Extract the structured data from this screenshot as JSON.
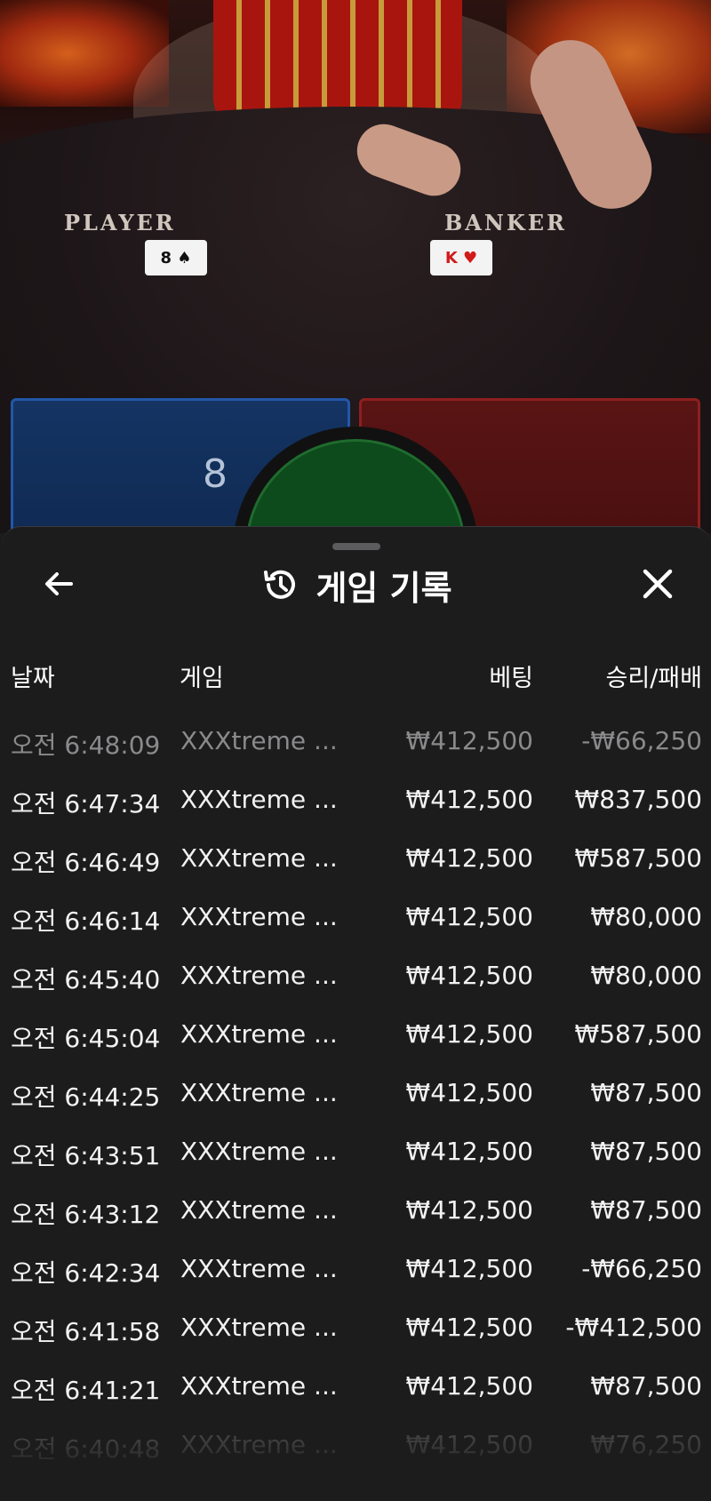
{
  "video": {
    "player_label": "PLAYER",
    "banker_label": "BANKER",
    "player_card": "8 ♠",
    "banker_card": "K ♥",
    "player_score": "8"
  },
  "sheet": {
    "title": "게임 기록",
    "title_icon": "history-icon",
    "back_icon": "arrow-left-icon",
    "close_icon": "close-icon",
    "columns": {
      "date": "날짜",
      "game": "게임",
      "bet": "베팅",
      "win_loss": "승리/패배"
    },
    "rows": [
      {
        "date": "오전 6:48:09",
        "game": "XXXtreme ...",
        "bet": "₩412,500",
        "win_loss": "-₩66,250"
      },
      {
        "date": "오전 6:47:34",
        "game": "XXXtreme ...",
        "bet": "₩412,500",
        "win_loss": "₩837,500"
      },
      {
        "date": "오전 6:46:49",
        "game": "XXXtreme ...",
        "bet": "₩412,500",
        "win_loss": "₩587,500"
      },
      {
        "date": "오전 6:46:14",
        "game": "XXXtreme ...",
        "bet": "₩412,500",
        "win_loss": "₩80,000"
      },
      {
        "date": "오전 6:45:40",
        "game": "XXXtreme ...",
        "bet": "₩412,500",
        "win_loss": "₩80,000"
      },
      {
        "date": "오전 6:45:04",
        "game": "XXXtreme ...",
        "bet": "₩412,500",
        "win_loss": "₩587,500"
      },
      {
        "date": "오전 6:44:25",
        "game": "XXXtreme ...",
        "bet": "₩412,500",
        "win_loss": "₩87,500"
      },
      {
        "date": "오전 6:43:51",
        "game": "XXXtreme ...",
        "bet": "₩412,500",
        "win_loss": "₩87,500"
      },
      {
        "date": "오전 6:43:12",
        "game": "XXXtreme ...",
        "bet": "₩412,500",
        "win_loss": "₩87,500"
      },
      {
        "date": "오전 6:42:34",
        "game": "XXXtreme ...",
        "bet": "₩412,500",
        "win_loss": "-₩66,250"
      },
      {
        "date": "오전 6:41:58",
        "game": "XXXtreme ...",
        "bet": "₩412,500",
        "win_loss": "-₩412,500"
      },
      {
        "date": "오전 6:41:21",
        "game": "XXXtreme ...",
        "bet": "₩412,500",
        "win_loss": "₩87,500"
      },
      {
        "date": "오전 6:40:48",
        "game": "XXXtreme ...",
        "bet": "₩412,500",
        "win_loss": "₩76,250"
      }
    ]
  },
  "colors": {
    "sheet_bg": "#1c1c1d",
    "player_blue": "#153463",
    "banker_red": "#5a1414",
    "tie_green": "#0d4a1c"
  }
}
